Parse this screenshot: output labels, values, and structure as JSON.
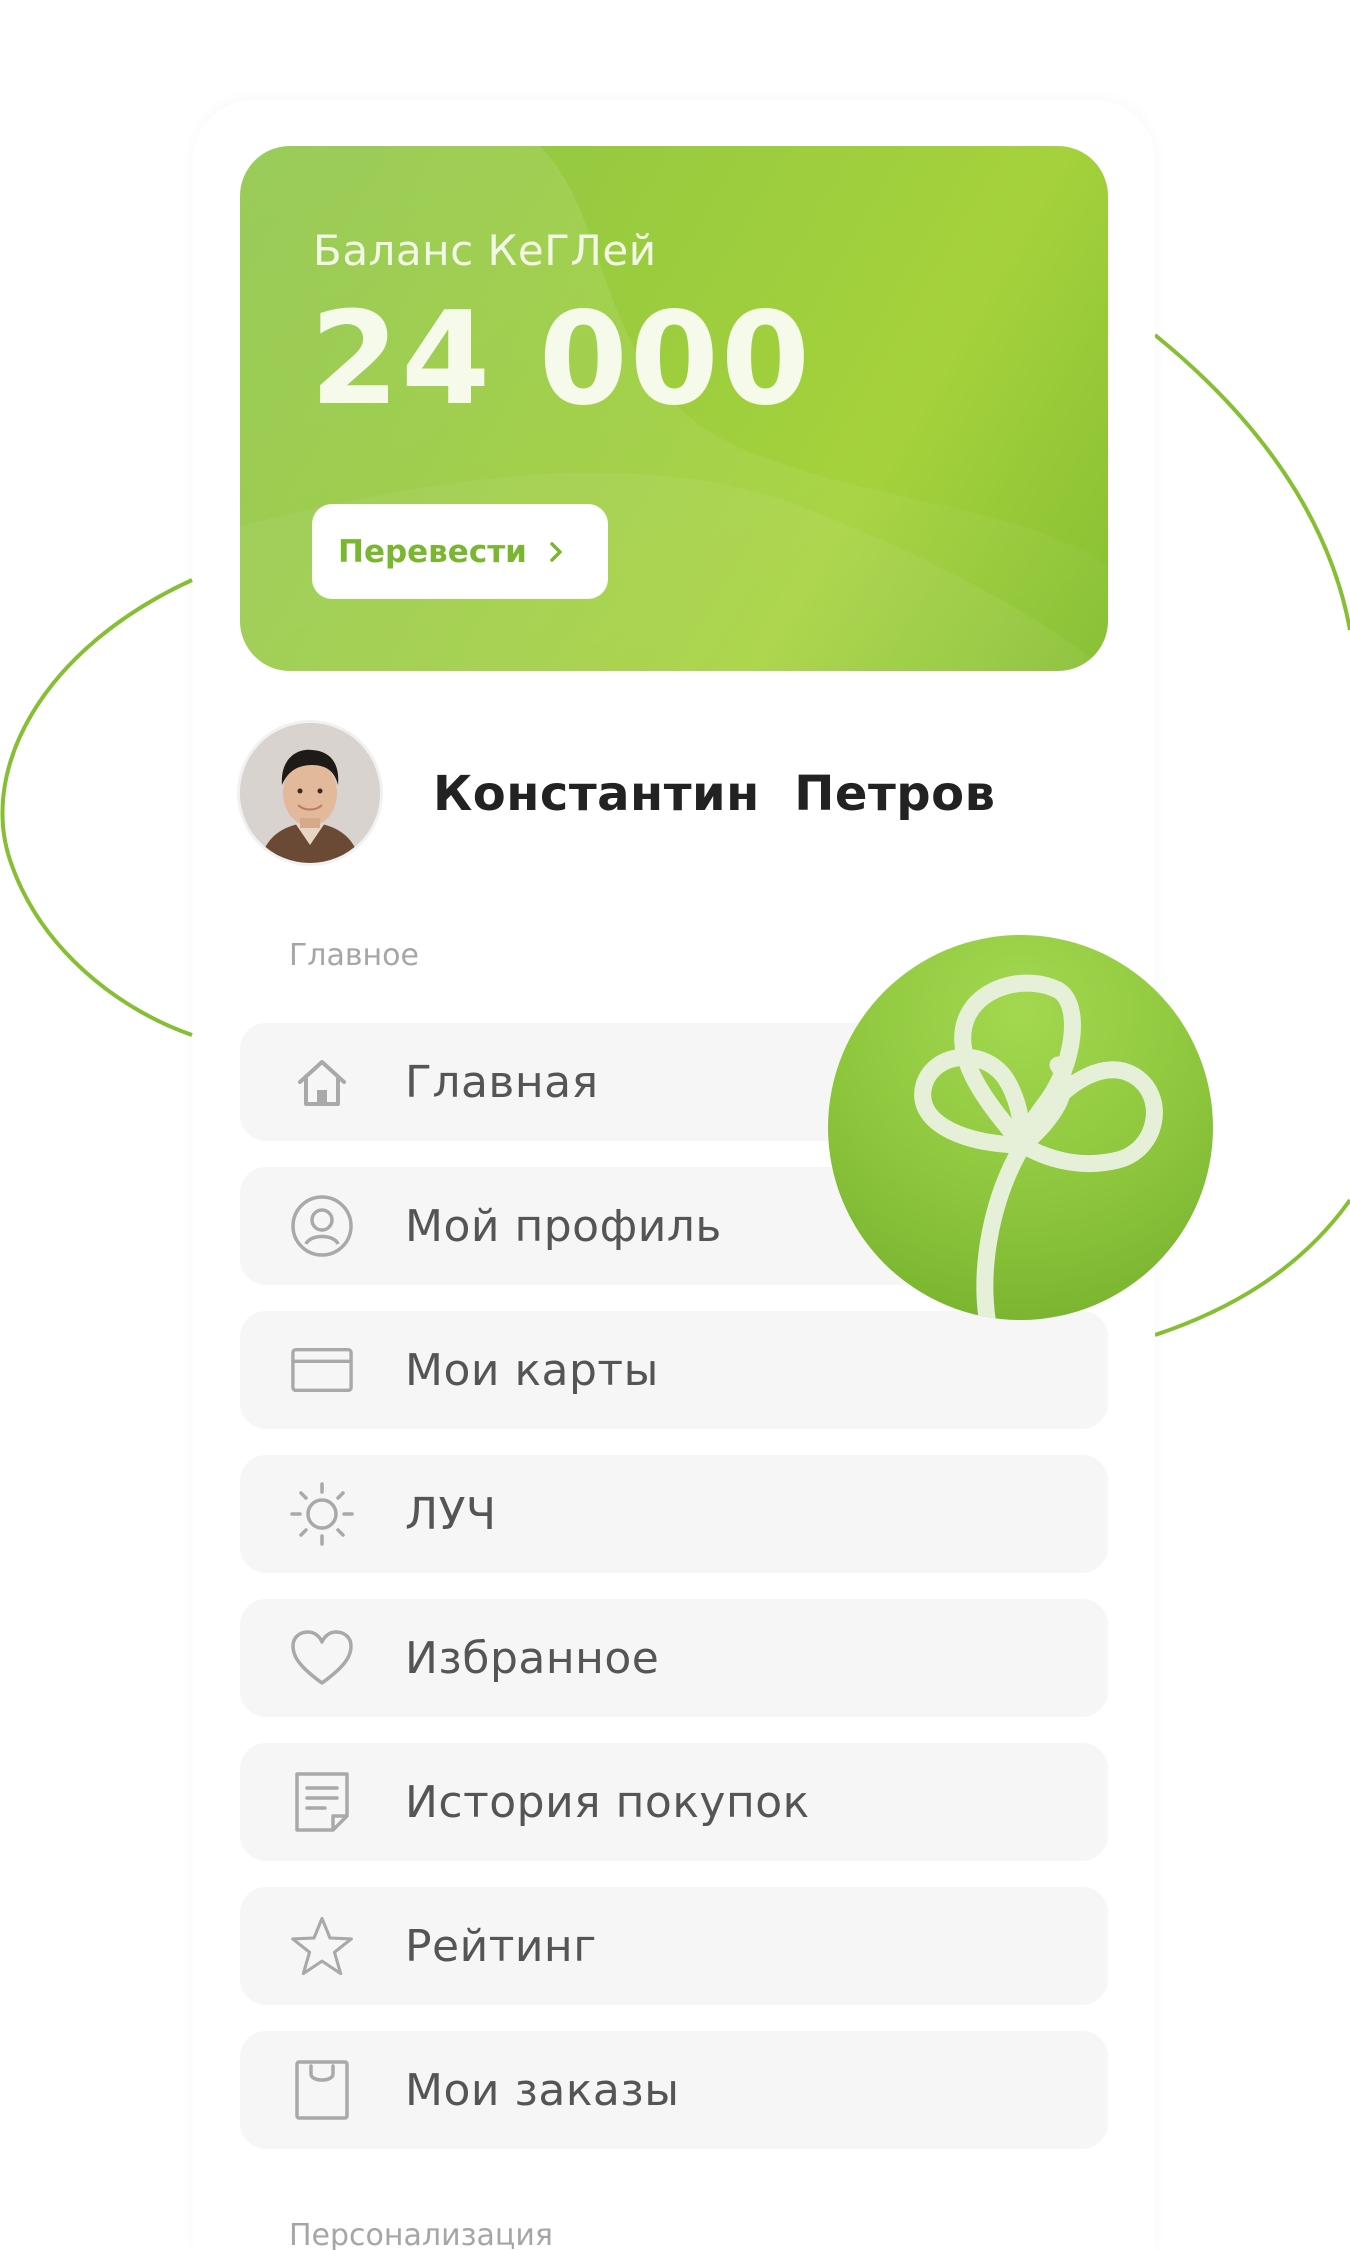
{
  "balance": {
    "title": "Баланс КеГЛей",
    "amount": "24 000",
    "transfer_label": "Перевести"
  },
  "profile": {
    "name": "Константин  Петров"
  },
  "sections": {
    "main": "Главное",
    "personalization": "Персонализация"
  },
  "menu": [
    {
      "label": "Главная",
      "icon": "home-icon"
    },
    {
      "label": "Мой профиль",
      "icon": "user-circle-icon"
    },
    {
      "label": "Мои карты",
      "icon": "card-icon"
    },
    {
      "label": "ЛУЧ",
      "icon": "sun-icon"
    },
    {
      "label": "Избранное",
      "icon": "heart-icon"
    },
    {
      "label": "История покупок",
      "icon": "receipt-icon"
    },
    {
      "label": "Рейтинг",
      "icon": "star-icon"
    },
    {
      "label": "Мои заказы",
      "icon": "bag-icon"
    }
  ],
  "colors": {
    "accent": "#8cc43c",
    "menu_bg": "#f6f6f6",
    "icon_gray": "#a9a9a9"
  }
}
